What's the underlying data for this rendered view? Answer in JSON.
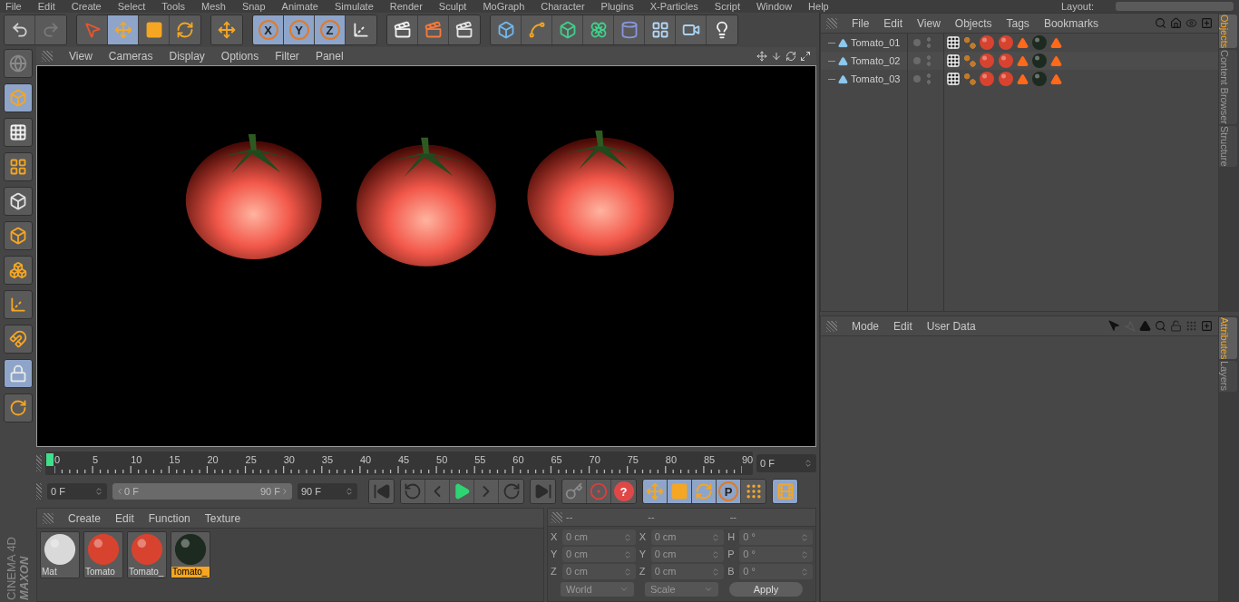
{
  "main_menu": {
    "items": [
      "File",
      "Edit",
      "Create",
      "Select",
      "Tools",
      "Mesh",
      "Snap",
      "Animate",
      "Simulate",
      "Render",
      "Sculpt",
      "MoGraph",
      "Character",
      "Plugins",
      "X-Particles",
      "Script",
      "Window",
      "Help"
    ],
    "layout_label": "Layout:"
  },
  "toolbar": [
    {
      "tools": [
        {
          "kind": "undo",
          "selected": false
        },
        {
          "kind": "redo",
          "selected": false
        }
      ]
    },
    {
      "tools": [
        {
          "kind": "select",
          "selected": false
        },
        {
          "kind": "move",
          "selected": true
        },
        {
          "kind": "scale",
          "selected": false
        },
        {
          "kind": "rotate",
          "selected": false
        }
      ]
    },
    {
      "tools": [
        {
          "kind": "move",
          "selected": false
        }
      ]
    },
    {
      "tools": [
        {
          "kind": "axis",
          "label": "X",
          "selected": true
        },
        {
          "kind": "axis",
          "label": "Y",
          "selected": true
        },
        {
          "kind": "axis",
          "label": "Z",
          "selected": true
        },
        {
          "kind": "world",
          "selected": false
        }
      ]
    },
    {
      "tools": [
        {
          "kind": "render-view",
          "selected": false
        },
        {
          "kind": "render-pv",
          "selected": false
        },
        {
          "kind": "render-settings",
          "selected": false
        }
      ]
    },
    {
      "tools": [
        {
          "kind": "cube",
          "selected": false
        },
        {
          "kind": "pen",
          "selected": false
        },
        {
          "kind": "subdiv",
          "selected": false
        },
        {
          "kind": "array",
          "selected": false
        },
        {
          "kind": "deformer",
          "selected": false
        },
        {
          "kind": "floor",
          "selected": false
        },
        {
          "kind": "camera",
          "selected": false
        },
        {
          "kind": "light",
          "selected": false
        }
      ]
    }
  ],
  "left_tools": [
    {
      "kind": "convert",
      "selected": false
    },
    {
      "kind": "model",
      "selected": true
    },
    {
      "kind": "texture",
      "selected": false
    },
    {
      "kind": "workplane",
      "selected": false
    },
    {
      "kind": "points",
      "selected": false
    },
    {
      "kind": "edges",
      "selected": false
    },
    {
      "kind": "polys",
      "selected": false
    },
    {
      "kind": "axis-mode",
      "selected": false
    },
    {
      "kind": "magnet",
      "selected": false
    },
    {
      "kind": "lock-workplane",
      "selected": true
    },
    {
      "kind": "planar",
      "selected": false
    }
  ],
  "viewport": {
    "menu": [
      "View",
      "Cameras",
      "Display",
      "Options",
      "Filter",
      "Panel"
    ]
  },
  "timeline": {
    "ticks": [
      "0",
      "5",
      "10",
      "15",
      "20",
      "25",
      "30",
      "35",
      "40",
      "45",
      "50",
      "55",
      "60",
      "65",
      "70",
      "75",
      "80",
      "85",
      "90"
    ],
    "level": 0,
    "current_frame": "0 F"
  },
  "transport": {
    "start": "0 F",
    "range": {
      "start": "0 F",
      "end": "90 F",
      "level": 1
    },
    "end": "90 F",
    "groups": [
      {
        "tools": [
          {
            "kind": "first",
            "selected": false
          }
        ]
      },
      {
        "tools": [
          {
            "kind": "prev-key",
            "selected": false
          },
          {
            "kind": "prev",
            "selected": false
          },
          {
            "kind": "play",
            "selected": false
          },
          {
            "kind": "next",
            "selected": false
          },
          {
            "kind": "next-key",
            "selected": false
          }
        ]
      },
      {
        "tools": [
          {
            "kind": "last",
            "selected": false
          }
        ]
      },
      {
        "tools": [
          {
            "kind": "keyframe",
            "selected": false
          },
          {
            "kind": "autokey",
            "selected": false
          },
          {
            "kind": "help",
            "label": "?",
            "selected": false
          }
        ]
      },
      {
        "tools": [
          {
            "kind": "move",
            "selected": true
          },
          {
            "kind": "scale",
            "selected": true
          },
          {
            "kind": "rotate",
            "selected": true
          },
          {
            "kind": "param",
            "label": "P",
            "selected": true
          },
          {
            "kind": "dots",
            "selected": false
          }
        ]
      },
      {
        "tools": [
          {
            "kind": "timeline",
            "selected": true
          }
        ]
      }
    ]
  },
  "material_manager": {
    "menu": [
      "Create",
      "Edit",
      "Function",
      "Texture"
    ],
    "materials": [
      {
        "name": "Mat",
        "color": "#d9d9d9",
        "selected": false
      },
      {
        "name": "Tomato",
        "color": "#d8432f",
        "selected": false
      },
      {
        "name": "Tomato_",
        "color": "#d8432f",
        "selected": false
      },
      {
        "name": "Tomato_",
        "color": "#1d2a1f",
        "selected": true
      }
    ]
  },
  "coordinates": {
    "headers": [
      "--",
      "--",
      "--"
    ],
    "columns": [
      [
        {
          "axis": "X",
          "value": "0 cm"
        },
        {
          "axis": "Y",
          "value": "0 cm"
        },
        {
          "axis": "Z",
          "value": "0 cm"
        }
      ],
      [
        {
          "axis": "X",
          "value": "0 cm"
        },
        {
          "axis": "Y",
          "value": "0 cm"
        },
        {
          "axis": "Z",
          "value": "0 cm"
        }
      ],
      [
        {
          "axis": "H",
          "value": "0 °"
        },
        {
          "axis": "P",
          "value": "0 °"
        },
        {
          "axis": "B",
          "value": "0 °"
        }
      ]
    ],
    "dropdowns": [
      "World",
      "Scale"
    ],
    "apply": "Apply"
  },
  "object_manager": {
    "menu": [
      "File",
      "Edit",
      "View",
      "Objects",
      "Tags",
      "Bookmarks"
    ],
    "objects": [
      {
        "name": "Tomato_01",
        "tags": [
          {
            "kind": "texture"
          },
          {
            "kind": "phong"
          },
          {
            "kind": "material",
            "color": "#d8432f"
          },
          {
            "kind": "material",
            "color": "#d8432f"
          },
          {
            "kind": "selection"
          },
          {
            "kind": "material",
            "color": "#1d2a1f"
          },
          {
            "kind": "selection"
          }
        ]
      },
      {
        "name": "Tomato_02",
        "tags": [
          {
            "kind": "texture"
          },
          {
            "kind": "phong"
          },
          {
            "kind": "material",
            "color": "#d8432f"
          },
          {
            "kind": "material",
            "color": "#d8432f"
          },
          {
            "kind": "selection"
          },
          {
            "kind": "material",
            "color": "#1d2a1f"
          },
          {
            "kind": "selection"
          }
        ]
      },
      {
        "name": "Tomato_03",
        "tags": [
          {
            "kind": "texture"
          },
          {
            "kind": "phong"
          },
          {
            "kind": "material",
            "color": "#d8432f"
          },
          {
            "kind": "material",
            "color": "#d8432f"
          },
          {
            "kind": "selection"
          },
          {
            "kind": "material",
            "color": "#1d2a1f"
          },
          {
            "kind": "selection"
          }
        ]
      }
    ],
    "side_tabs": [
      {
        "label": "Objects",
        "selected": true
      },
      {
        "label": "Content Browser",
        "selected": false
      },
      {
        "label": "Structure",
        "selected": false
      }
    ]
  },
  "attributes": {
    "menu": [
      "Mode",
      "Edit",
      "User Data"
    ],
    "side_tabs": [
      {
        "label": "Attributes",
        "selected": true
      },
      {
        "label": "Layers",
        "selected": false
      }
    ]
  },
  "logo": {
    "brand": "MAXON",
    "product": "CINEMA 4D"
  }
}
